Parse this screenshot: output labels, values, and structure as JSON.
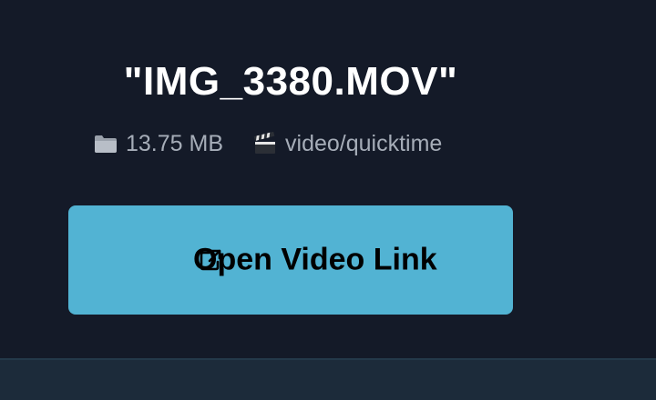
{
  "file": {
    "title": "\"IMG_3380.MOV\"",
    "size_icon": "folder-icon",
    "size": "13.75 MB",
    "type_icon": "clapperboard-icon",
    "type": "video/quicktime"
  },
  "action": {
    "icon": "external-link-icon",
    "label": "Open Video Link"
  },
  "colors": {
    "background": "#141a28",
    "button": "#52b3d3",
    "footer": "#1c2b3a",
    "meta_text": "#a6adb8"
  }
}
